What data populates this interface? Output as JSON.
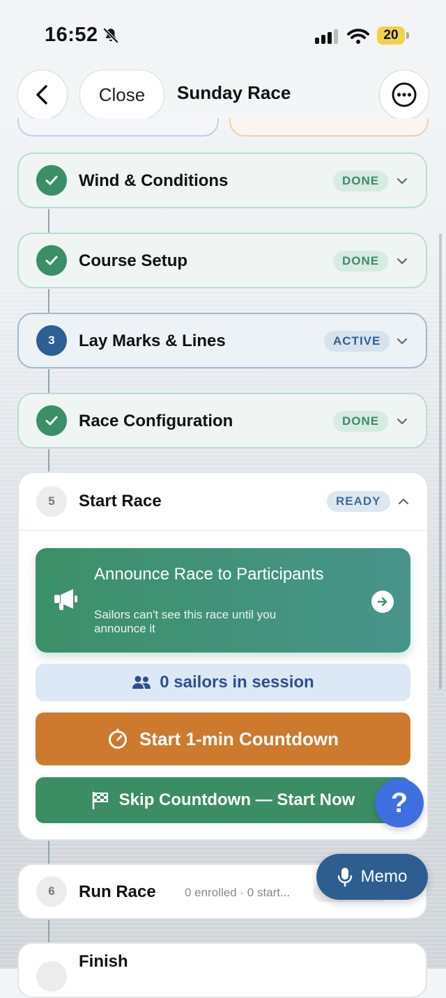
{
  "status_bar": {
    "time": "16:52",
    "battery": "20"
  },
  "header": {
    "close_label": "Close",
    "title": "Sunday Race"
  },
  "steps": [
    {
      "number": "",
      "label": "Wind & Conditions",
      "status": "DONE"
    },
    {
      "number": "",
      "label": "Course Setup",
      "status": "DONE"
    },
    {
      "number": "3",
      "label": "Lay Marks & Lines",
      "status": "ACTIVE"
    },
    {
      "number": "",
      "label": "Race Configuration",
      "status": "DONE"
    },
    {
      "number": "5",
      "label": "Start Race",
      "status": "READY"
    },
    {
      "number": "6",
      "label": "Run Race",
      "meta": "0 enrolled · 0 start..."
    },
    {
      "number": "",
      "label": "Finish"
    }
  ],
  "start_race": {
    "announce_title": "Announce Race to Participants",
    "announce_subtitle": "Sailors can't see this race until you announce it",
    "session_text": "0 sailors in session",
    "countdown_label": "Start 1-min Countdown",
    "skip_label": "Skip Countdown — Start Now"
  },
  "help_label": "?",
  "memo_label": "Memo",
  "colors": {
    "done_green": "#3a8f66",
    "active_blue": "#2b5f95",
    "countdown_orange": "#cd7a2e",
    "help_blue": "#3d6fe0",
    "memo_blue": "#2d5e8f"
  }
}
